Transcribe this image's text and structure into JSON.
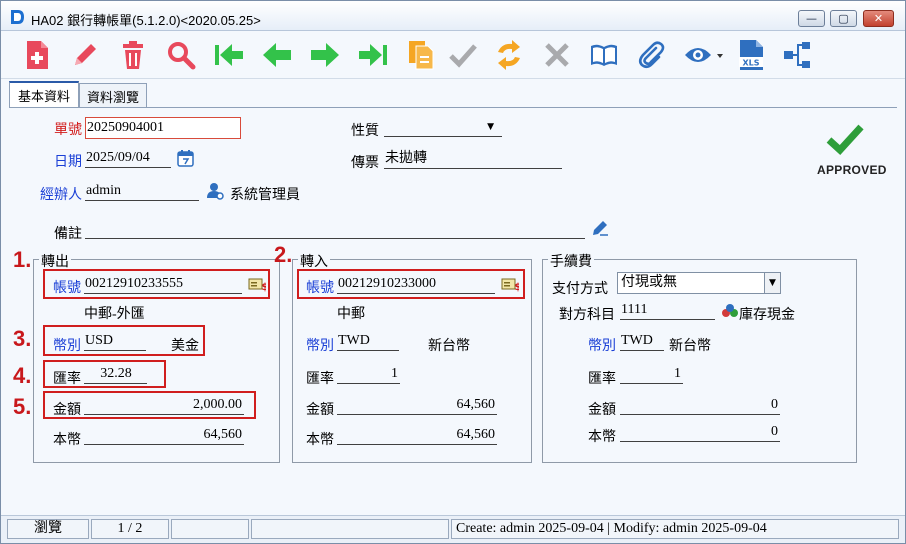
{
  "window": {
    "title": "HA02 銀行轉帳單(5.1.2.0)<2020.05.25>",
    "minimize_glyph": "—",
    "maximize_glyph": "▢",
    "close_glyph": "✕"
  },
  "toolbar": {
    "buttons": [
      "new-file-icon",
      "edit-pencil-icon",
      "delete-trash-icon",
      "search-icon",
      "first-record-icon",
      "previous-record-icon",
      "next-record-icon",
      "last-record-icon",
      "copy-icon",
      "confirm-check-icon",
      "refresh-icon",
      "cancel-x-icon",
      "book-icon",
      "attachment-icon",
      "view-eye-icon",
      "export-xls-icon",
      "tree-structure-icon"
    ],
    "xls_text": "XLS"
  },
  "tabs": [
    {
      "label": "基本資料"
    },
    {
      "label": "資料瀏覽"
    }
  ],
  "form": {
    "doc_no_label": "單號",
    "doc_no": "20250904001",
    "nature_label": "性質",
    "nature_value": "",
    "date_label": "日期",
    "date": "2025/09/04",
    "voucher_label": "傳票",
    "voucher": "未拋轉",
    "handler_label": "經辦人",
    "handler": "admin",
    "handler_name": "系統管理員",
    "remark_label": "備註",
    "remark": "",
    "status_text": "APPROVED"
  },
  "transfer_out": {
    "title": "轉出",
    "account_label": "帳號",
    "account": "00212910233555",
    "bank_name": "中郵-外匯",
    "currency_label": "幣別",
    "currency": "USD",
    "currency_name": "美金",
    "rate_label": "匯率",
    "rate": "32.28",
    "amount_label": "金額",
    "amount": "2,000.00",
    "local_label": "本幣",
    "local_amount": "64,560"
  },
  "transfer_in": {
    "title": "轉入",
    "account_label": "帳號",
    "account": "00212910233000",
    "bank_name": "中郵",
    "currency_label": "幣別",
    "currency": "TWD",
    "currency_name": "新台幣",
    "rate_label": "匯率",
    "rate": "1",
    "amount_label": "金額",
    "amount": "64,560",
    "local_label": "本幣",
    "local_amount": "64,560"
  },
  "fee": {
    "title": "手續費",
    "payment_label": "支付方式",
    "payment": "付現或無",
    "account_label": "對方科目",
    "account": "1111",
    "account_name": "庫存現金",
    "currency_label": "幣別",
    "currency": "TWD",
    "currency_name": "新台幣",
    "rate_label": "匯率",
    "rate": "1",
    "amount_label": "金額",
    "amount": "0",
    "local_label": "本幣",
    "local_amount": "0"
  },
  "annotations": [
    "1.",
    "2.",
    "3.",
    "4.",
    "5."
  ],
  "statusbar": {
    "mode": "瀏覽",
    "record": "1 / 2",
    "audit": "Create: admin 2025-09-04 | Modify: admin 2025-09-04"
  },
  "colors": {
    "toolbar_green": "#33c24a",
    "delete_red": "#e8495c",
    "highlight_box": "#d01e1e",
    "label_blue": "#1a3fd6",
    "approved_check": "#2e9e3a"
  }
}
